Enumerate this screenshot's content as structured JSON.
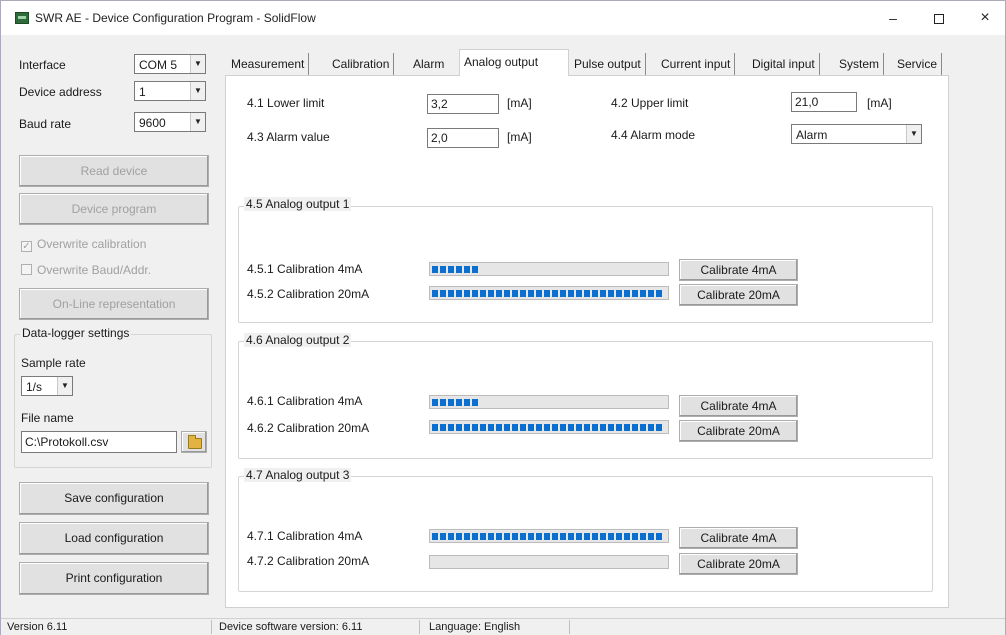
{
  "window": {
    "title": "SWR AE - Device Configuration Program - SolidFlow",
    "minimize_label": "–",
    "close_label": "×"
  },
  "left_panel": {
    "interface": {
      "label": "Interface",
      "value": "COM 5"
    },
    "device_address": {
      "label": "Device address",
      "value": "1"
    },
    "baud_rate": {
      "label": "Baud rate",
      "value": "9600"
    },
    "read_device": "Read device",
    "device_program": "Device program",
    "overwrite_calibration": {
      "label": "Overwrite calibration",
      "checked": true
    },
    "overwrite_baud": {
      "label": "Overwrite Baud/Addr.",
      "checked": false
    },
    "online_representation": "On-Line representation",
    "datalogger": {
      "title": "Data-logger settings",
      "sample_rate_label": "Sample rate",
      "sample_rate_value": "1/s",
      "file_name_label": "File name",
      "file_name_value": "C:\\Protokoll.csv"
    },
    "save_configuration": "Save configuration",
    "load_configuration": "Load configuration",
    "print_configuration": "Print configuration"
  },
  "tabs": [
    "Measurement",
    "Calibration",
    "Alarm",
    "Analog output",
    "Pulse output",
    "Current input",
    "Digital input",
    "System",
    "Service"
  ],
  "active_tab": "Analog output",
  "analog": {
    "lower_limit": {
      "label": "4.1 Lower limit",
      "value": "3,2",
      "unit": "[mA]"
    },
    "upper_limit": {
      "label": "4.2 Upper limit",
      "value": "21,0",
      "unit": "[mA]"
    },
    "alarm_value": {
      "label": "4.3 Alarm value",
      "value": "2,0",
      "unit": "[mA]"
    },
    "alarm_mode": {
      "label": "4.4 Alarm mode",
      "value": "Alarm"
    },
    "outputs": [
      {
        "title": "4.5 Analog output 1",
        "rows": [
          {
            "label": "4.5.1 Calibration 4mA",
            "progress": 0.2,
            "button": "Calibrate 4mA"
          },
          {
            "label": "4.5.2 Calibration 20mA",
            "progress": 1.0,
            "button": "Calibrate 20mA"
          }
        ]
      },
      {
        "title": "4.6 Analog output 2",
        "rows": [
          {
            "label": "4.6.1 Calibration 4mA",
            "progress": 0.2,
            "button": "Calibrate 4mA"
          },
          {
            "label": "4.6.2 Calibration 20mA",
            "progress": 1.0,
            "button": "Calibrate 20mA"
          }
        ]
      },
      {
        "title": "4.7 Analog output 3",
        "rows": [
          {
            "label": "4.7.1 Calibration 4mA",
            "progress": 1.0,
            "button": "Calibrate 4mA"
          },
          {
            "label": "4.7.2 Calibration 20mA",
            "progress": 0.0,
            "button": "Calibrate 20mA"
          }
        ]
      }
    ]
  },
  "statusbar": {
    "version": "Version 6.11",
    "device_software": "Device software version: 6.11",
    "language": "Language: English"
  },
  "colors": {
    "progress_fill": "#0b6fd0",
    "window_bg": "#f0f0f0",
    "panel_bg": "#ffffff"
  }
}
